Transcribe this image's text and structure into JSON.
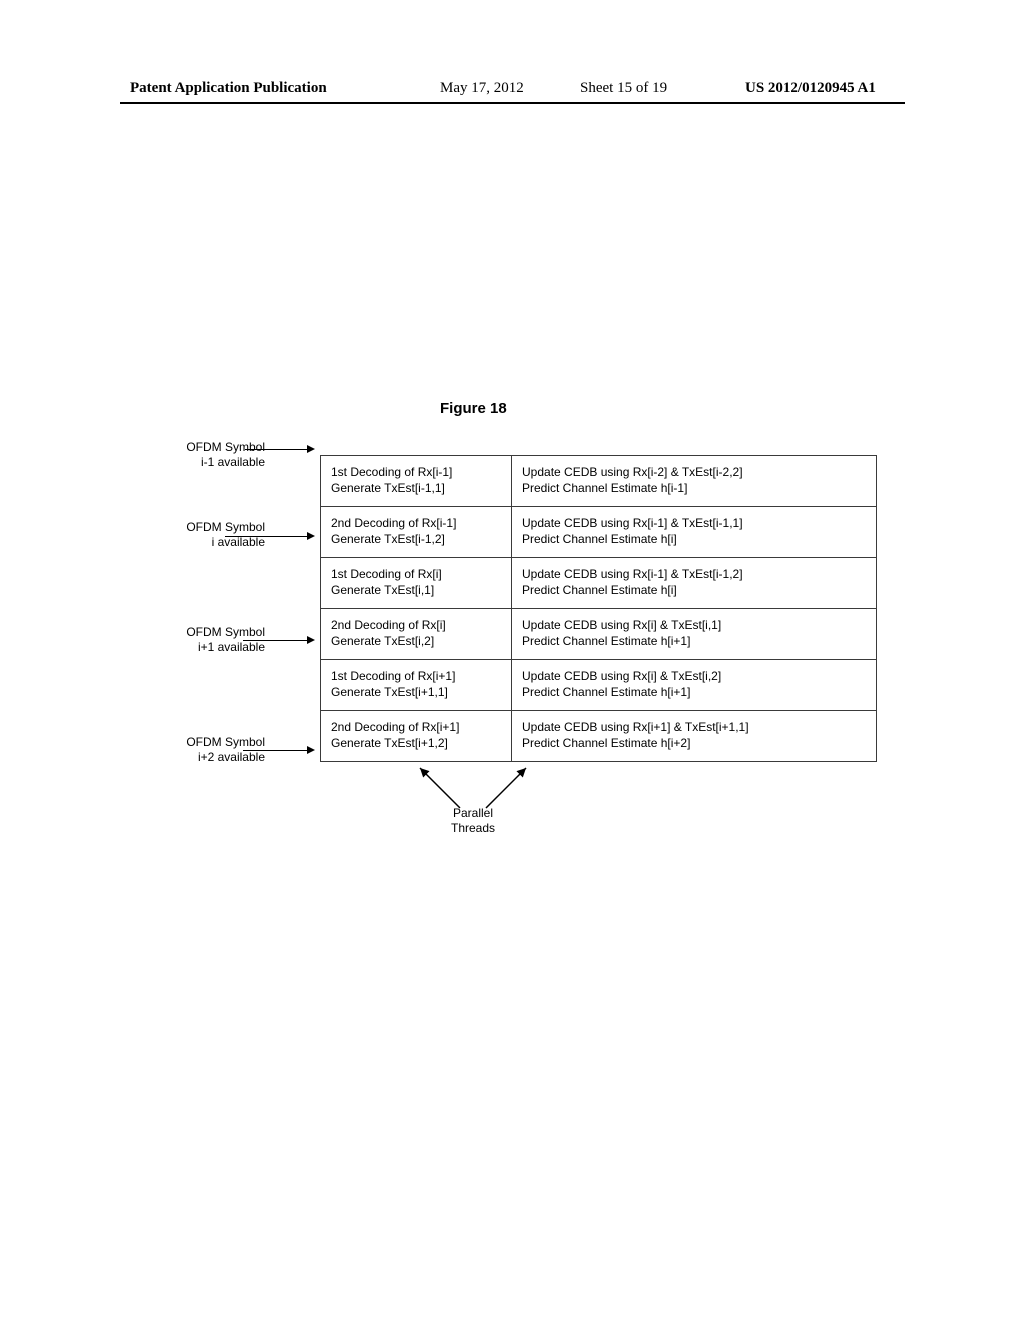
{
  "header": {
    "left": "Patent Application Publication",
    "date": "May 17, 2012",
    "sheet": "Sheet 15 of 19",
    "right": "US 2012/0120945 A1"
  },
  "figure_title": "Figure 18",
  "labels": {
    "l0": "OFDM Symbol\ni-1 available",
    "l1": "OFDM Symbol\ni available",
    "l2": "OFDM Symbol\ni+1 available",
    "l3": "OFDM Symbol\ni+2 available"
  },
  "rows": [
    {
      "left": "1st Decoding of Rx[i-1]\nGenerate TxEst[i-1,1]",
      "right": "Update CEDB using Rx[i-2] & TxEst[i-2,2]\nPredict Channel Estimate h[i-1]"
    },
    {
      "left": "2nd Decoding of Rx[i-1]\nGenerate TxEst[i-1,2]",
      "right": "Update CEDB using Rx[i-1] & TxEst[i-1,1]\nPredict Channel Estimate h[i]"
    },
    {
      "left": "1st Decoding of Rx[i]\nGenerate TxEst[i,1]",
      "right": "Update CEDB using Rx[i-1] & TxEst[i-1,2]\nPredict Channel Estimate h[i]"
    },
    {
      "left": "2nd Decoding of Rx[i]\nGenerate TxEst[i,2]",
      "right": "Update CEDB using Rx[i] & TxEst[i,1]\nPredict Channel Estimate h[i+1]"
    },
    {
      "left": "1st Decoding of Rx[i+1]\nGenerate TxEst[i+1,1]",
      "right": "Update CEDB using Rx[i] & TxEst[i,2]\nPredict Channel Estimate h[i+1]"
    },
    {
      "left": "2nd Decoding of Rx[i+1]\nGenerate TxEst[i+1,2]",
      "right": "Update CEDB using Rx[i+1] & TxEst[i+1,1]\nPredict Channel Estimate h[i+2]"
    }
  ],
  "callout": "Parallel\nThreads"
}
